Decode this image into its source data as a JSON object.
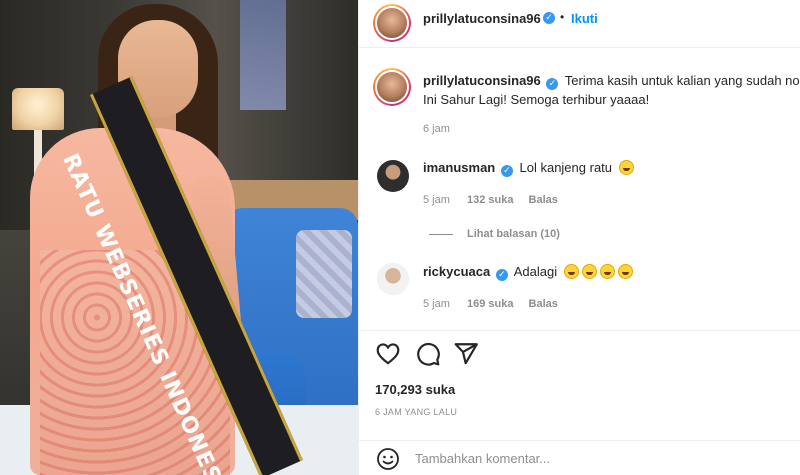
{
  "post": {
    "author": "prillylatuconsina96",
    "follow_label": "Ikuti",
    "separator": "•",
    "caption_line1": "Terima kasih untuk kalian yang sudah no",
    "caption_line2": "Ini Sahur Lagi! Semoga terhibur yaaaa!",
    "caption_time": "6 jam",
    "sash_text": "RATU WEBSERIES INDONESIA"
  },
  "comments": [
    {
      "username": "imanusman",
      "text": "Lol kanjeng ratu",
      "time": "5 jam",
      "likes": "132 suka",
      "reply": "Balas",
      "emoji": [
        "laughing-tears"
      ],
      "view_replies": "Lihat balasan (10)"
    },
    {
      "username": "rickycuaca",
      "text": "Adalagi",
      "time": "5 jam",
      "likes": "169 suka",
      "reply": "Balas",
      "emoji": [
        "laughing-tears",
        "laughing-tears",
        "laughing-tears",
        "laughing-tears"
      ]
    }
  ],
  "actions": {
    "icons": [
      "heart-icon",
      "comment-icon",
      "share-icon"
    ],
    "likes_count": "170,293 suka",
    "posted_ago": "6 JAM YANG LALU"
  },
  "comment_box": {
    "placeholder": "Tambahkan komentar...",
    "icon": "emoji-icon"
  },
  "colors": {
    "accent": "#0095f6",
    "verified": "#3897f0",
    "text": "#262626",
    "muted": "#8e8e8e"
  }
}
